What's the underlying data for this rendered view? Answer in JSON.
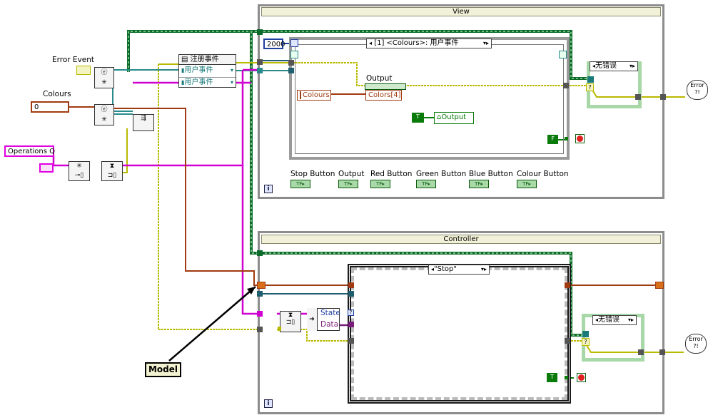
{
  "view_frame": {
    "title": "View"
  },
  "controller_frame": {
    "title": "Controller"
  },
  "view_loop": {
    "timeout_value": "2000",
    "event_case_selector": "[1] <Colours>: 用户事件",
    "output_label": "Output",
    "colours_label": "Colours",
    "colors_index_label": "Colors[4]",
    "output_property": "Output",
    "true_const": "T",
    "false_const": "F"
  },
  "error_case_view": {
    "selector": "无错误"
  },
  "error_case_controller": {
    "selector": "无错误"
  },
  "controller_loop": {
    "case_selector": "\"Stop\"",
    "state_label": "State",
    "data_label": "Data",
    "true_const": "T"
  },
  "left_area": {
    "error_event_label": "Error Event",
    "colours_label": "Colours",
    "colours_value": "0",
    "operations_q_label": "Operations Q",
    "register_events_label": "注册事件",
    "user_event_1": "用户事件",
    "user_event_2": "用户事件"
  },
  "bool_controls": [
    {
      "label": "Stop Button"
    },
    {
      "label": "Output"
    },
    {
      "label": "Red Button"
    },
    {
      "label": "Green Button"
    },
    {
      "label": "Blue Button"
    },
    {
      "label": "Colour Button"
    }
  ],
  "annotation": {
    "model_label": "Model"
  },
  "error_bubble_text": "Error\n?!",
  "info_icon": "i",
  "colors": {
    "error_wire": "#c8c800",
    "event_wire": "#1a7a7a",
    "class_wire": "#e000e0",
    "colour_wire": "#a03a10",
    "numeric_wire": "#1f3fa0",
    "bool_wire": "#0a7a0a",
    "frame_gray": "#8c8c8c"
  }
}
